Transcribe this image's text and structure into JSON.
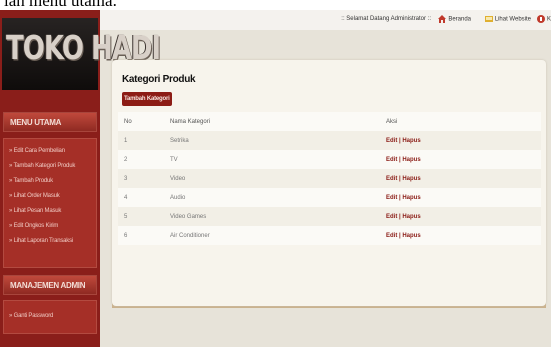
{
  "caption": "lah menu utama.",
  "sidebar": {
    "logo": "TOKO HADI",
    "menu_utama": {
      "title": "MENU UTAMA",
      "items": [
        "» Edit Cara Pembelian",
        "» Tambah Kategori Produk",
        "» Tambah Produk",
        "» Lihat Order Masuk",
        "» Lihat Pesan Masuk",
        "» Edit Ongkos Kirim",
        "» Lihat Laporan Transaksi"
      ]
    },
    "manajemen": {
      "title": "MANAJEMEN ADMIN",
      "items": [
        "» Ganti Password"
      ]
    }
  },
  "topbar": {
    "welcome": ":: Selamat Datang Administrator ::",
    "beranda": "Beranda",
    "lihat_website": "Lihat Website",
    "keluar": "K"
  },
  "main": {
    "title": "Kategori Produk",
    "add_button": "Tambah Kategori",
    "table": {
      "headers": [
        "No",
        "Nama Kategori",
        "Aksi"
      ],
      "rows": [
        {
          "no": "1",
          "name": "Setrika",
          "action": "Edit | Hapus"
        },
        {
          "no": "2",
          "name": "TV",
          "action": "Edit | Hapus"
        },
        {
          "no": "3",
          "name": "Video",
          "action": "Edit | Hapus"
        },
        {
          "no": "4",
          "name": "Audio",
          "action": "Edit | Hapus"
        },
        {
          "no": "5",
          "name": "Video Games",
          "action": "Edit | Hapus"
        },
        {
          "no": "6",
          "name": "Air Conditioner",
          "action": "Edit | Hapus"
        }
      ]
    }
  },
  "colors": {
    "sidebar": "#8a1e1a",
    "accent": "#8c1c15",
    "background": "#e7e3d9"
  }
}
